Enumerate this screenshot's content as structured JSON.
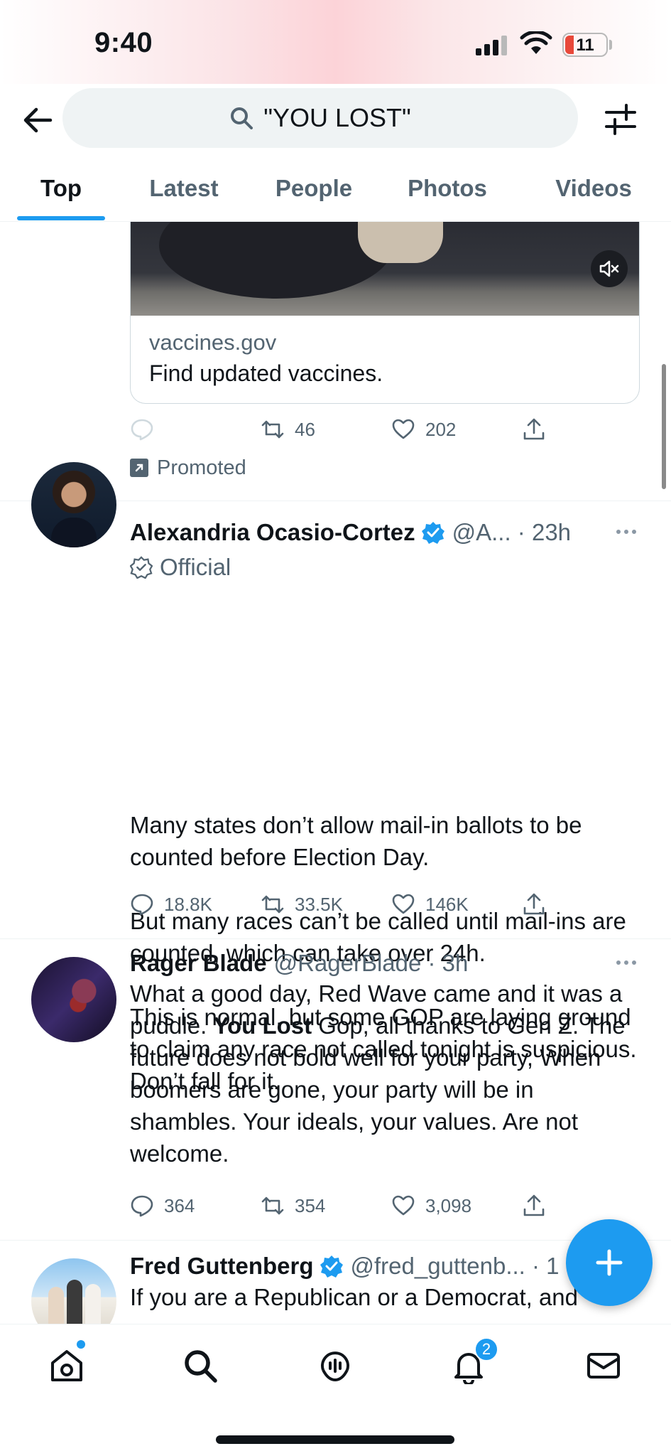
{
  "status_bar": {
    "time": "9:40",
    "battery": "11"
  },
  "search": {
    "query": "\"YOU LOST\""
  },
  "tabs": [
    {
      "label": "Top",
      "active": true
    },
    {
      "label": "Latest",
      "active": false
    },
    {
      "label": "People",
      "active": false
    },
    {
      "label": "Photos",
      "active": false
    },
    {
      "label": "Videos",
      "active": false
    }
  ],
  "ad": {
    "domain": "vaccines.gov",
    "title": "Find updated vaccines.",
    "retweets": "46",
    "likes": "202",
    "promoted_label": "Promoted"
  },
  "tweets": [
    {
      "author": "Alexandria Ocasio-Cortez",
      "handle_time": "@A... · 23h",
      "official_label": "Official",
      "text": [
        "Many states don’t allow mail-in ballots to be counted before Election Day.",
        "But many races can’t be called until mail-ins are counted, which can take over 24h.",
        "This is normal, but some GOP are laying ground to claim any race not called tonight is suspicious. Don’t fall for it."
      ],
      "replies": "18.8K",
      "retweets": "33.5K",
      "likes": "146K"
    },
    {
      "author": "Rager Blade",
      "handle_time": "@RagerBlade · 3h",
      "text_before": "What a good day, Red Wave came and it was a puddle. ",
      "text_bold": "You Lost",
      "text_after": " Gop, all thanks to Gen Z. The future does not bold well for your party, When boomers are gone, your party will be in shambles. Your ideals, your values. Are not welcome.",
      "replies": "364",
      "retweets": "354",
      "likes": "3,098"
    },
    {
      "author": "Fred Guttenberg",
      "handle_time": "@fred_guttenb... · 1",
      "text": "If you are a Republican or a Democrat, and"
    }
  ],
  "nav": {
    "notifications_badge": "2"
  },
  "colors": {
    "accent": "#1d9bf0",
    "text": "#0f1419",
    "secondary": "#536471"
  }
}
